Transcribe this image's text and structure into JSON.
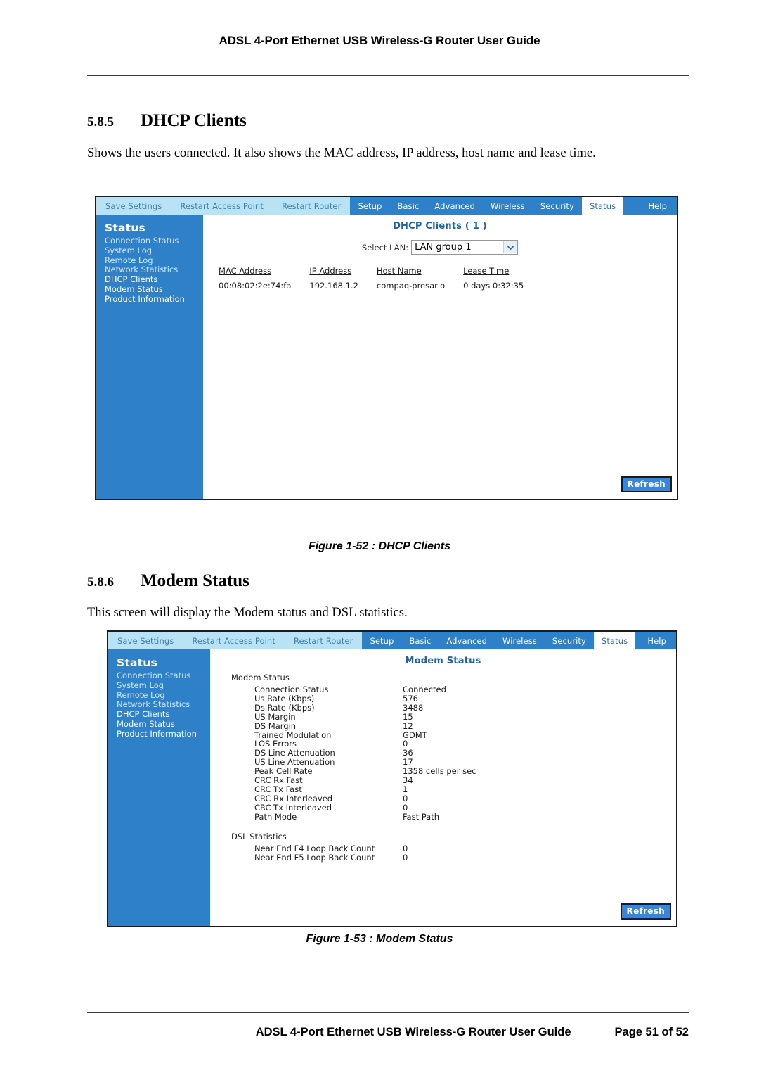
{
  "document": {
    "header_title": "ADSL 4-Port Ethernet USB Wireless-G Router User Guide",
    "footer_title": "ADSL 4-Port Ethernet USB Wireless-G Router User Guide",
    "footer_page": "Page 51 of 52"
  },
  "sections": [
    {
      "number": "5.8.5",
      "title": "DHCP Clients",
      "body": "Shows the users connected. It also shows the MAC address, IP address, host name and lease time.",
      "figure_caption": "Figure 1-52 : DHCP Clients"
    },
    {
      "number": "5.8.6",
      "title": "Modem Status",
      "body": "This screen will display the Modem status and DSL statistics.",
      "figure_caption": "Figure 1-53 : Modem Status"
    }
  ],
  "router_ui": {
    "nav_left": [
      "Save Settings",
      "Restart Access Point",
      "Restart Router"
    ],
    "nav_right": [
      "Setup",
      "Basic",
      "Advanced",
      "Wireless",
      "Security",
      "Status"
    ],
    "nav_active": "Status",
    "nav_help": "Help",
    "sidebar": {
      "title": "Status",
      "items": [
        "Connection Status",
        "System Log",
        "Remote Log",
        "Network Statistics",
        "DHCP Clients",
        "Modem Status",
        "Product Information"
      ]
    },
    "refresh_label": "Refresh",
    "colors": {
      "nav_left_bg": "#b9e3f5",
      "nav_right_bg": "#2e80c8",
      "sidebar_bg": "#2e80c8",
      "panel_title": "#1d62a8",
      "button_bg": "#3a85d8"
    }
  },
  "dhcp_screen": {
    "panel_title": "DHCP Clients ( 1 )",
    "select_lan_label": "Select LAN:",
    "select_lan_value": "LAN group 1",
    "columns": [
      "MAC Address",
      "IP Address",
      "Host Name",
      "Lease Time"
    ],
    "rows": [
      [
        "00:08:02:2e:74:fa",
        "192.168.1.2",
        "compaq-presario",
        "0 days 0:32:35"
      ]
    ]
  },
  "modem_screen": {
    "panel_title": "Modem Status",
    "groups": [
      {
        "label": "Modem Status",
        "rows": [
          [
            "Connection Status",
            "Connected"
          ],
          [
            "Us Rate (Kbps)",
            "576"
          ],
          [
            "Ds Rate (Kbps)",
            "3488"
          ],
          [
            "US Margin",
            "15"
          ],
          [
            "DS Margin",
            "12"
          ],
          [
            "Trained Modulation",
            "GDMT"
          ],
          [
            "LOS Errors",
            "0"
          ],
          [
            "DS Line Attenuation",
            "36"
          ],
          [
            "US Line Attenuation",
            "17"
          ],
          [
            "Peak Cell Rate",
            "1358 cells per sec"
          ],
          [
            "CRC Rx Fast",
            "34"
          ],
          [
            "CRC Tx Fast",
            "1"
          ],
          [
            "CRC Rx Interleaved",
            "0"
          ],
          [
            "CRC Tx Interleaved",
            "0"
          ],
          [
            "Path Mode",
            "Fast Path"
          ]
        ]
      },
      {
        "label": "DSL Statistics",
        "rows": [
          [
            "Near End F4 Loop Back Count",
            "0"
          ],
          [
            "Near End F5 Loop Back Count",
            "0"
          ]
        ]
      }
    ]
  }
}
